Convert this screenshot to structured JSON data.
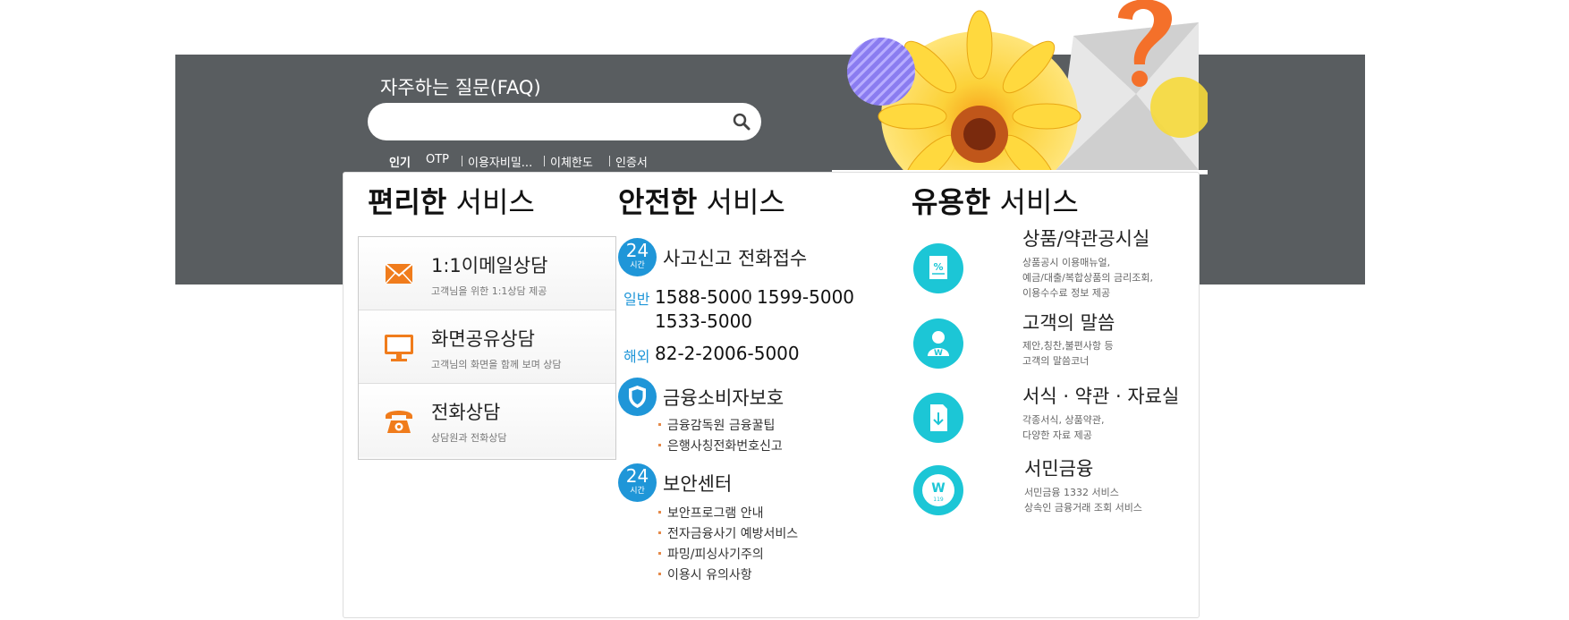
{
  "header": {
    "faq_title": "자주하는 질문(FAQ)",
    "search_placeholder": "",
    "keywords_label": "인기",
    "keywords": [
      "OTP",
      "이용자비밀...",
      "이체한도",
      "인증서"
    ]
  },
  "convenient": {
    "title_bold": "편리한",
    "title_light": " 서비스",
    "cards": [
      {
        "title": "1:1이메일상담",
        "sub": "고객님을 위한 1:1상담 제공",
        "icon": "envelope-icon"
      },
      {
        "title": "화면공유상담",
        "sub": "고객님의 화면을 함께 보며 상담",
        "icon": "monitor-icon"
      },
      {
        "title": "전화상담",
        "sub": "상담원과 전화상담",
        "icon": "telephone-icon"
      }
    ]
  },
  "safe": {
    "title_bold": "안전한",
    "title_light": " 서비스",
    "badge_num": "24",
    "badge_sub": "시간",
    "accident_title": "사고신고 전화접수",
    "general_label": "일반",
    "general_numbers": [
      "1588-5000",
      "1599-5000",
      "1533-5000"
    ],
    "overseas_label": "해외",
    "overseas_number": "82-2-2006-5000",
    "consumer_title": "금융소비자보호",
    "consumer_items": [
      "금융감독원 금융꿀팁",
      "은행사칭전화번호신고"
    ],
    "security_title": "보안센터",
    "security_items": [
      "보안프로그램 안내",
      "전자금융사기 예방서비스",
      "파밍/피싱사기주의",
      "이용시 유의사항"
    ]
  },
  "useful": {
    "title_bold": "유용한",
    "title_light": " 서비스",
    "items": [
      {
        "title": "상품/약관공시실",
        "desc": [
          "상품공시 이용매뉴얼,",
          "예금/대출/복합상품의 금리조회,",
          "이용수수료 정보 제공"
        ],
        "icon": "percent-document-icon"
      },
      {
        "title": "고객의 말씀",
        "desc": [
          "제안,칭찬,불편사항 등",
          "고객의 말씀코너"
        ],
        "icon": "person-icon"
      },
      {
        "title": "서식 · 약관 · 자료실",
        "desc": [
          "각종서식, 상품약관,",
          "다양한 자료 제공"
        ],
        "icon": "download-document-icon"
      },
      {
        "title": "서민금융",
        "desc": [
          "서민금융 1332 서비스",
          "상속인 금융거래 조회 서비스"
        ],
        "icon": "w-119-icon"
      }
    ]
  },
  "colors": {
    "banner": "#595d60",
    "blue": "#1f96d8",
    "teal": "#1cc6d6",
    "orange": "#f07c1c"
  }
}
